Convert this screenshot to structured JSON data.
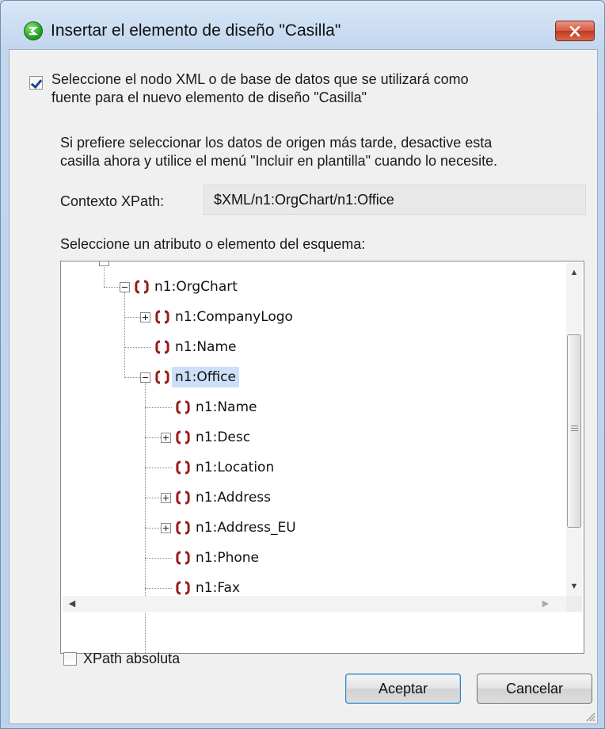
{
  "window": {
    "title": "Insertar el elemento de diseño \"Casilla\""
  },
  "source_checkbox": {
    "checked": true,
    "line1": "Seleccione el nodo XML o de base de datos que se utilizará como",
    "line2": "fuente para el nuevo elemento de diseño \"Casilla\""
  },
  "hint": {
    "line1": "Si prefiere seleccionar los datos de origen más tarde, desactive esta",
    "line2": "casilla ahora y utilice el menú \"Incluir en plantilla\" cuando lo necesite."
  },
  "context": {
    "label": "Contexto XPath:",
    "value": "$XML/n1:OrgChart/n1:Office"
  },
  "tree": {
    "label": "Seleccione un atributo o elemento del esquema:",
    "nodes": [
      {
        "label": "n1:OrgChart",
        "expander": "minus",
        "selected": false
      },
      {
        "label": "n1:CompanyLogo",
        "expander": "plus",
        "selected": false
      },
      {
        "label": "n1:Name",
        "expander": "none",
        "selected": false
      },
      {
        "label": "n1:Office",
        "expander": "minus",
        "selected": true
      },
      {
        "label": "n1:Name",
        "expander": "none",
        "selected": false
      },
      {
        "label": "n1:Desc",
        "expander": "plus",
        "selected": false
      },
      {
        "label": "n1:Location",
        "expander": "none",
        "selected": false
      },
      {
        "label": "n1:Address",
        "expander": "plus",
        "selected": false
      },
      {
        "label": "n1:Address_EU",
        "expander": "plus",
        "selected": false
      },
      {
        "label": "n1:Phone",
        "expander": "none",
        "selected": false
      },
      {
        "label": "n1:Fax",
        "expander": "none",
        "selected": false
      }
    ]
  },
  "absolute_xpath": {
    "label": "XPath absoluta",
    "checked": false
  },
  "buttons": {
    "ok": "Aceptar",
    "cancel": "Cancelar"
  },
  "colors": {
    "element_icon": "#9a1c1c",
    "selection": "#cce0f7"
  },
  "icons": {
    "app": "altova-stylevision-icon",
    "close": "close-icon",
    "element": "xml-element-icon"
  }
}
